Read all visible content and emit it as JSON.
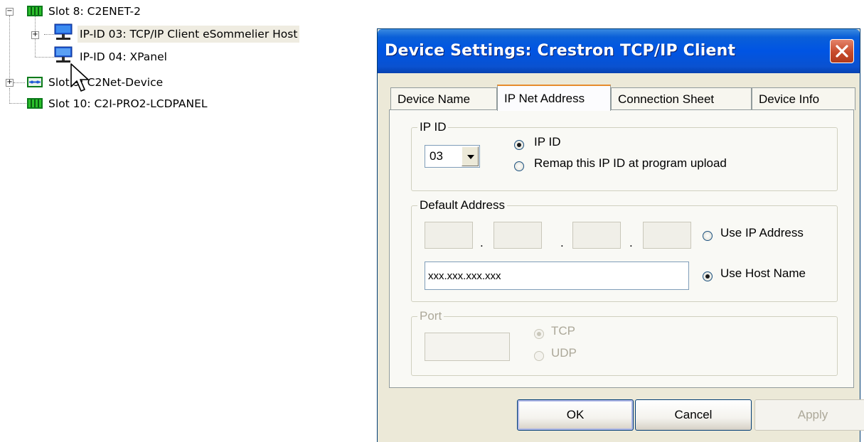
{
  "tree": {
    "items": [
      {
        "label": "Slot 8: C2ENET-2",
        "expander": "minus",
        "icon": "slot-card-icon"
      },
      {
        "label": "IP-ID 03: TCP/IP Client eSommelier Host",
        "expander": "plus",
        "icon": "network-pc-icon",
        "selected": true
      },
      {
        "label": "IP-ID 04: XPanel",
        "expander": "",
        "icon": "network-pc-icon"
      },
      {
        "label": "Slot 9: C2Net-Device",
        "expander": "plus",
        "icon": "net-card-icon"
      },
      {
        "label": "Slot 10: C2I-PRO2-LCDPANEL",
        "expander": "",
        "icon": "slot-card-icon"
      }
    ]
  },
  "dialog": {
    "title": "Device Settings: Crestron TCP/IP Client",
    "tabs": [
      "Device Name",
      "IP Net Address",
      "Connection Sheet",
      "Device Info"
    ],
    "active_tab": "IP Net Address",
    "ipid_group": {
      "legend": "IP ID",
      "selected_value": "03",
      "options": [
        {
          "label": "IP ID",
          "checked": true
        },
        {
          "label": "Remap this IP ID at program upload",
          "checked": false
        }
      ]
    },
    "address_group": {
      "legend": "Default Address",
      "ip_octets": [
        "",
        "",
        "",
        ""
      ],
      "ip_option": {
        "label": "Use IP Address",
        "checked": false
      },
      "host_value": "xxx.xxx.xxx.xxx",
      "host_option": {
        "label": "Use Host Name",
        "checked": true
      }
    },
    "port_group": {
      "legend": "Port",
      "value": "",
      "options": [
        {
          "label": "TCP",
          "checked": true,
          "disabled": true
        },
        {
          "label": "UDP",
          "checked": false,
          "disabled": true
        }
      ]
    },
    "buttons": {
      "ok": "OK",
      "cancel": "Cancel",
      "apply": "Apply"
    }
  },
  "colors": {
    "titlebar": "#0054e3",
    "dialog_face": "#ece9d8",
    "tab_highlight": "#e68b2c",
    "selection_bg": "#efece1",
    "close_button": "#c74a2b"
  }
}
